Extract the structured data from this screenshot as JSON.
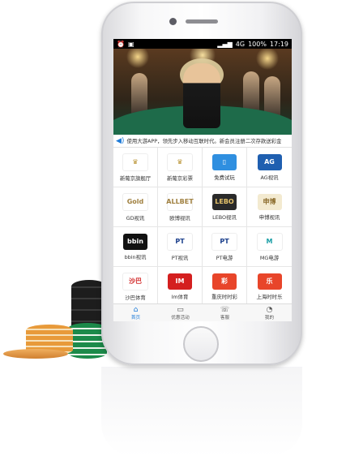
{
  "status_bar": {
    "network": "4G",
    "battery": "100%",
    "time": "17:19"
  },
  "announcement": {
    "text": "使用大游APP，领先步入移动互联时代。新会员注册二次存款送彩金"
  },
  "grid_items": [
    {
      "label": "新葡京旗舰厅",
      "logo_text": "♛",
      "logo_bg": "#ffffff",
      "logo_fg": "#b8912f"
    },
    {
      "label": "新葡京彩票",
      "logo_text": "♛",
      "logo_bg": "#ffffff",
      "logo_fg": "#b8912f"
    },
    {
      "label": "免费试玩",
      "logo_text": "▯",
      "logo_bg": "#2f8fe0",
      "logo_fg": "#ffffff"
    },
    {
      "label": "AG视讯",
      "logo_text": "AG",
      "logo_bg": "#1f5fb0",
      "logo_fg": "#ffffff"
    },
    {
      "label": "GD视讯",
      "logo_text": "Gold",
      "logo_bg": "#ffffff",
      "logo_fg": "#a08040"
    },
    {
      "label": "欧博视讯",
      "logo_text": "ALLBET",
      "logo_bg": "#ffffff",
      "logo_fg": "#a08040"
    },
    {
      "label": "LEBO视讯",
      "logo_text": "LEBO",
      "logo_bg": "#2a2a2a",
      "logo_fg": "#e6c36a"
    },
    {
      "label": "申博视讯",
      "logo_text": "申博",
      "logo_bg": "#f3ead0",
      "logo_fg": "#8a6a2a"
    },
    {
      "label": "bbin视讯",
      "logo_text": "bbin",
      "logo_bg": "#111111",
      "logo_fg": "#ffffff"
    },
    {
      "label": "PT视讯",
      "logo_text": "PT",
      "logo_bg": "#ffffff",
      "logo_fg": "#1b3f8c"
    },
    {
      "label": "PT电游",
      "logo_text": "PT",
      "logo_bg": "#ffffff",
      "logo_fg": "#1b3f8c"
    },
    {
      "label": "MG电游",
      "logo_text": "M",
      "logo_bg": "#ffffff",
      "logo_fg": "#1a9ea6"
    },
    {
      "label": "沙巴体育",
      "logo_text": "沙巴",
      "logo_bg": "#ffffff",
      "logo_fg": "#d22a2a"
    },
    {
      "label": "Im体育",
      "logo_text": "IM",
      "logo_bg": "#d41f1f",
      "logo_fg": "#ffffff"
    },
    {
      "label": "重庆时时彩",
      "logo_text": "彩",
      "logo_bg": "#e8452a",
      "logo_fg": "#ffffff"
    },
    {
      "label": "上海时时乐",
      "logo_text": "乐",
      "logo_bg": "#e8452a",
      "logo_fg": "#ffffff"
    }
  ],
  "tabs": [
    {
      "label": "首页",
      "icon": "home-icon",
      "glyph": "⌂"
    },
    {
      "label": "优惠活动",
      "icon": "gift-icon",
      "glyph": "▭"
    },
    {
      "label": "客服",
      "icon": "phone-icon",
      "glyph": "☏"
    },
    {
      "label": "我的",
      "icon": "user-icon",
      "glyph": "◔"
    }
  ],
  "colors": {
    "accent": "#1e7bd8"
  }
}
